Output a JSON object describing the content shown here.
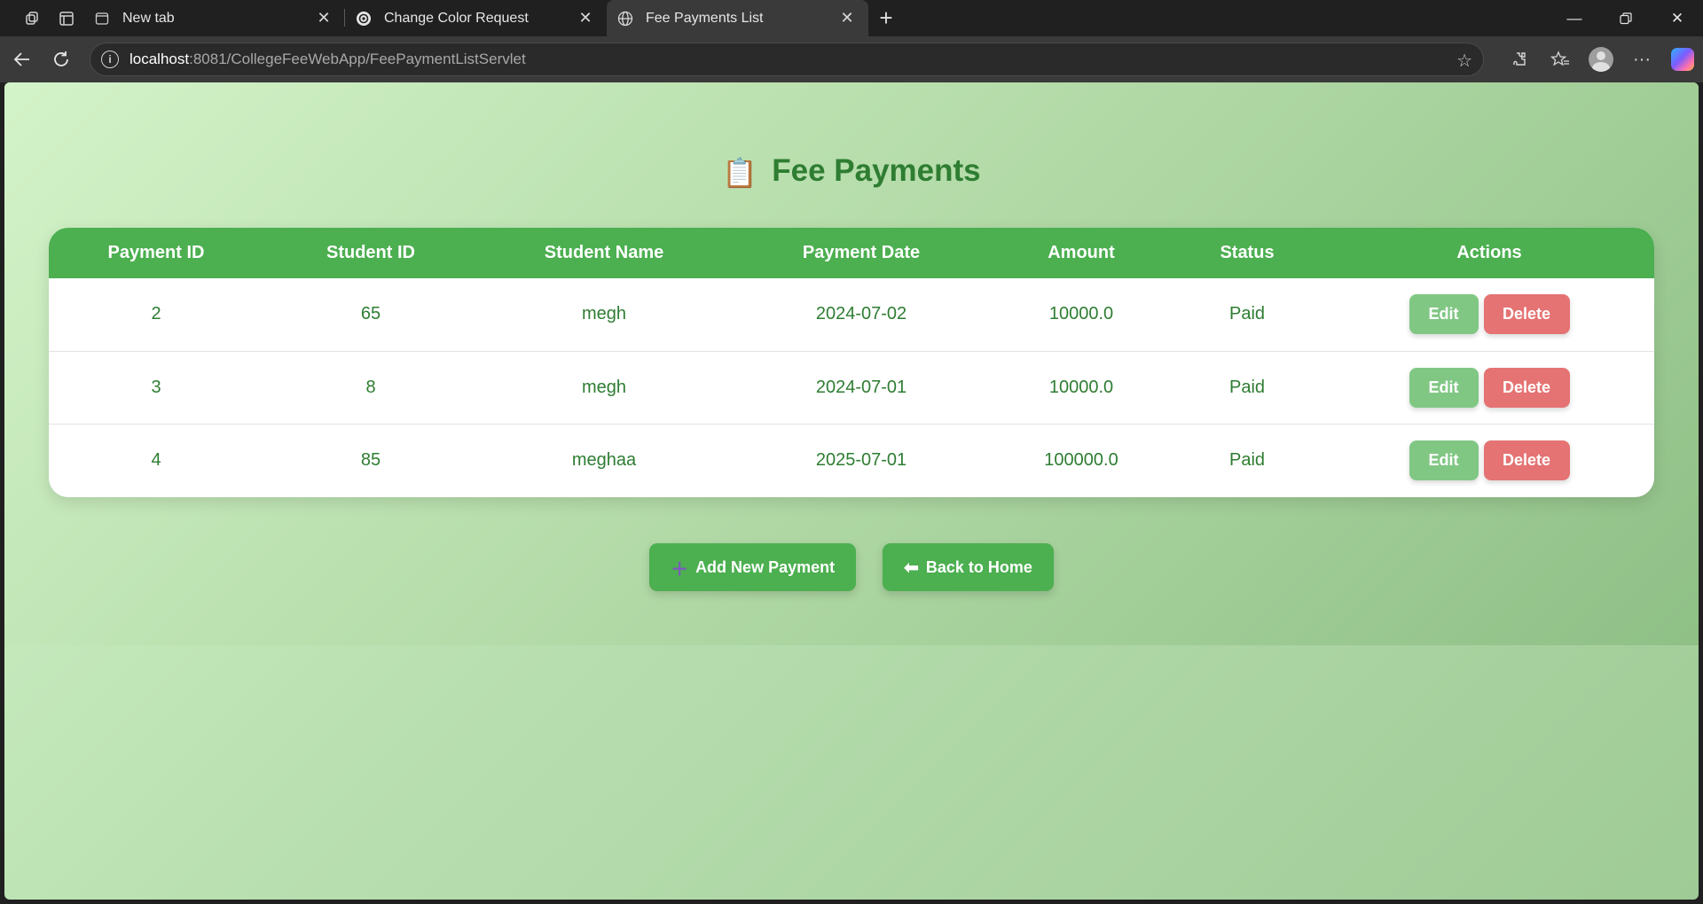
{
  "browser": {
    "tabs": [
      {
        "title": "New tab",
        "icon": "newtab-page-icon",
        "active": false
      },
      {
        "title": "Change Color Request",
        "icon": "openai-icon",
        "active": false
      },
      {
        "title": "Fee Payments List",
        "icon": "globe-icon",
        "active": true
      }
    ],
    "url_host": "localhost",
    "url_rest": ":8081/CollegeFeeWebApp/FeePaymentListServlet"
  },
  "page": {
    "title": "Fee Payments",
    "title_icon": "📋",
    "columns": [
      "Payment ID",
      "Student ID",
      "Student Name",
      "Payment Date",
      "Amount",
      "Status",
      "Actions"
    ],
    "rows": [
      {
        "payment_id": "2",
        "student_id": "65",
        "name": "megh",
        "date": "2024-07-02",
        "amount": "10000.0",
        "status": "Paid"
      },
      {
        "payment_id": "3",
        "student_id": "8",
        "name": "megh",
        "date": "2024-07-01",
        "amount": "10000.0",
        "status": "Paid"
      },
      {
        "payment_id": "4",
        "student_id": "85",
        "name": "meghaa",
        "date": "2025-07-01",
        "amount": "100000.0",
        "status": "Paid"
      }
    ],
    "edit_label": "Edit",
    "delete_label": "Delete",
    "add_icon": "＋",
    "add_label": "Add New Payment",
    "back_icon": "⬅",
    "back_label": "Back to Home"
  },
  "colors": {
    "header_green": "#4caf50",
    "text_green": "#2e7d32",
    "edit_green": "#81c784",
    "delete_red": "#e57373"
  }
}
